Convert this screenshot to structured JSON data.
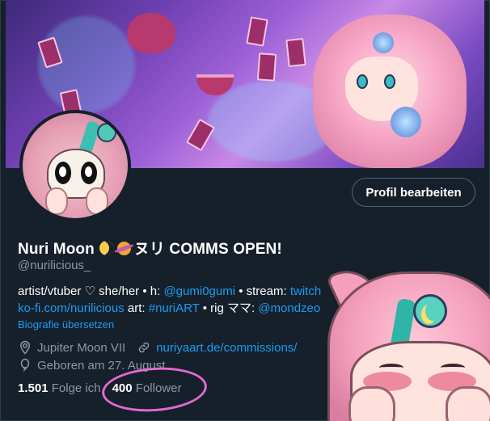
{
  "profile": {
    "display_name": "Nuri Moon",
    "name_suffix": "ヌリ COMMS OPEN!",
    "handle": "@nurilicious_",
    "edit_button_label": "Profil bearbeiten",
    "bio": {
      "line1_text_a": "artist/vtuber ♡ she/her • h: ",
      "line1_link_a": "@gumi0gumi",
      "line1_text_b": " • stream: ",
      "line1_link_b": "twitch",
      "line2_link_a": "ko-fi.com/nurilicious",
      "line2_text_a": " art: ",
      "line2_link_b": "#nuriART",
      "line2_text_b": " • rig ママ: ",
      "line2_link_c": "@mondzeo"
    },
    "translate_label": "Biografie übersetzen",
    "location": "Jupiter Moon VII",
    "website": "nuriyaart.de/commissions/",
    "birthday": "Geboren am 27. August",
    "following_count": "1.501",
    "following_label": "Folge ich",
    "followers_count": "400",
    "followers_label": "Follower"
  },
  "icons": {
    "location": "location-pin-icon",
    "website": "link-icon",
    "birthday": "balloon-icon",
    "moon_emoji": "crescent-moon-icon",
    "planet_emoji": "ringed-planet-icon"
  },
  "colors": {
    "background": "#15202b",
    "link": "#1d9bf0",
    "secondary_text": "#8b98a5",
    "highlight_circle": "#e36ad0"
  }
}
